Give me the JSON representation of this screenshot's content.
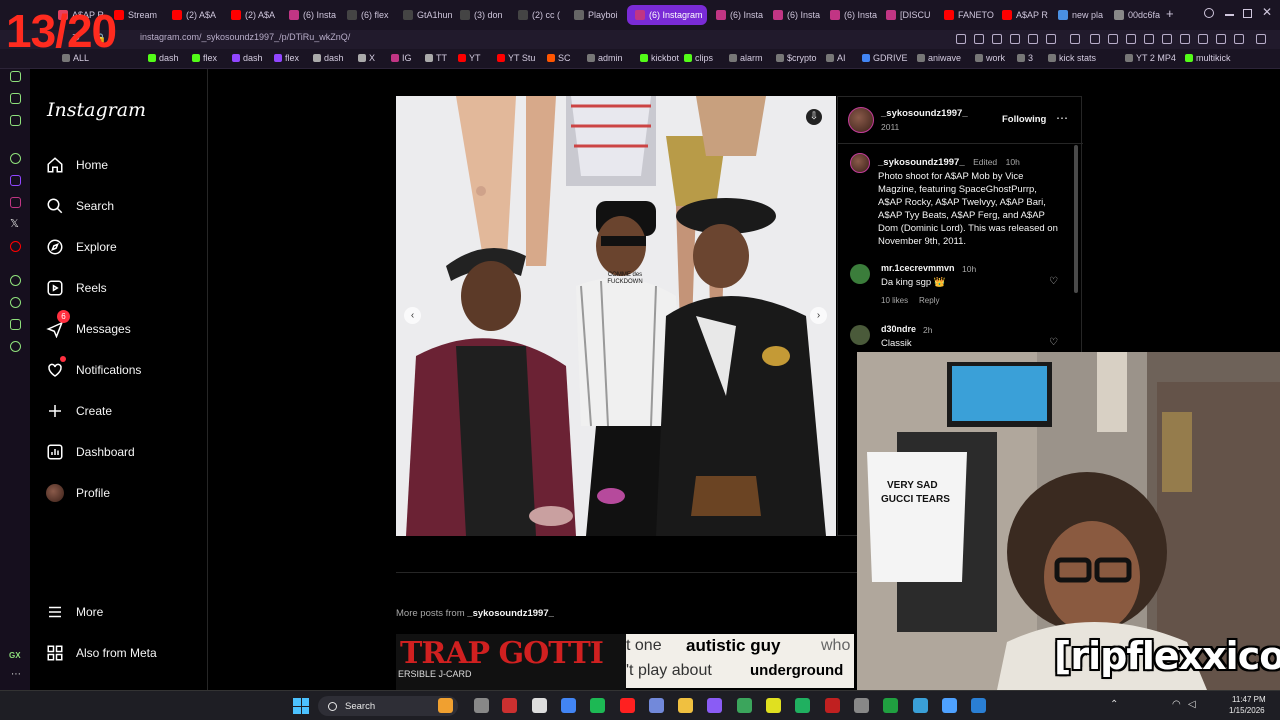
{
  "overlay_counter": "13/20",
  "browser": {
    "url": "instagram.com/_sykosoundz1997_/p/DTiRu_wkZnQ/",
    "tabs": [
      {
        "label": "A$AP R",
        "color": "#e4405f"
      },
      {
        "label": "Stream",
        "color": "#ff0000"
      },
      {
        "label": "(2) A$A",
        "color": "#ff0000"
      },
      {
        "label": "(2) A$A",
        "color": "#ff0000"
      },
      {
        "label": "(6) Insta",
        "color": "#c13584"
      },
      {
        "label": "(6) flex",
        "color": "#444"
      },
      {
        "label": "GtA1hun",
        "color": "#444"
      },
      {
        "label": "(3) don",
        "color": "#444"
      },
      {
        "label": "(2) cc (",
        "color": "#444"
      },
      {
        "label": "Playboi",
        "color": "#666"
      },
      {
        "label": "(6) Instagram",
        "color": "#c13584"
      },
      {
        "label": "(6) Insta",
        "color": "#c13584"
      },
      {
        "label": "(6) Insta",
        "color": "#c13584"
      },
      {
        "label": "(6) Insta",
        "color": "#c13584"
      },
      {
        "label": "[DISCU",
        "color": "#c13584"
      },
      {
        "label": "FANETO",
        "color": "#ff0000"
      },
      {
        "label": "A$AP R",
        "color": "#ff0000"
      },
      {
        "label": "new pla",
        "color": "#4a90e2"
      },
      {
        "label": "00dc6fa",
        "color": "#888"
      }
    ],
    "bookmarks": [
      {
        "label": "ALL",
        "color": "#777"
      },
      {
        "label": "dash",
        "color": "#53fc18"
      },
      {
        "label": "flex",
        "color": "#53fc18"
      },
      {
        "label": "dash",
        "color": "#9146ff"
      },
      {
        "label": "flex",
        "color": "#9146ff"
      },
      {
        "label": "dash",
        "color": "#aaa"
      },
      {
        "label": "X",
        "color": "#aaa"
      },
      {
        "label": "IG",
        "color": "#c13584"
      },
      {
        "label": "TT",
        "color": "#aaa"
      },
      {
        "label": "YT",
        "color": "#ff0000"
      },
      {
        "label": "YT Stu",
        "color": "#ff0000"
      },
      {
        "label": "SC",
        "color": "#ff5500"
      },
      {
        "label": "admin",
        "color": "#777"
      },
      {
        "label": "kickbot",
        "color": "#53fc18"
      },
      {
        "label": "clips",
        "color": "#53fc18"
      },
      {
        "label": "alarm",
        "color": "#777"
      },
      {
        "label": "$crypto",
        "color": "#777"
      },
      {
        "label": "AI",
        "color": "#777"
      },
      {
        "label": "GDRIVE",
        "color": "#4285f4"
      },
      {
        "label": "aniwave",
        "color": "#777"
      },
      {
        "label": "work",
        "color": "#777"
      },
      {
        "label": "3",
        "color": "#777"
      },
      {
        "label": "kick stats",
        "color": "#777"
      },
      {
        "label": "YT 2 MP4",
        "color": "#777"
      },
      {
        "label": "multikick",
        "color": "#53fc18"
      }
    ]
  },
  "instagram": {
    "logo": "Instagram",
    "nav": [
      {
        "label": "Home",
        "icon": "home-icon"
      },
      {
        "label": "Search",
        "icon": "search-icon"
      },
      {
        "label": "Explore",
        "icon": "explore-icon"
      },
      {
        "label": "Reels",
        "icon": "reels-icon"
      },
      {
        "label": "Messages",
        "icon": "messages-icon",
        "badge": "6"
      },
      {
        "label": "Notifications",
        "icon": "heart-icon"
      },
      {
        "label": "Create",
        "icon": "plus-icon"
      },
      {
        "label": "Dashboard",
        "icon": "dashboard-icon"
      },
      {
        "label": "Profile",
        "icon": "profile-avatar"
      }
    ],
    "bottom_nav": [
      {
        "label": "More",
        "icon": "menu-icon"
      },
      {
        "label": "Also from Meta",
        "icon": "meta-icon"
      }
    ]
  },
  "post": {
    "username": "_sykosoundz1997_",
    "header_sub": "2011",
    "follow_label": "Following",
    "caption_user": "_sykosoundz1997_",
    "caption_edited": "Edited",
    "caption_time": "10h",
    "caption": "Photo shoot for A$AP Mob by Vice Magzine, featuring SpaceGhostPurrp, A$AP Rocky, A$AP Twelvyy, A$AP Bari, A$AP Tyy Beats, A$AP Ferg, and A$AP Dom (Dominic Lord). This was released on November 9th, 2011.",
    "comments": [
      {
        "user": "mr.1cecrevmmvn",
        "time": "10h",
        "text": "Da king sgp 👑",
        "likes": "10 likes",
        "reply": "Reply"
      },
      {
        "user": "d30ndre",
        "time": "2h",
        "text": "Classik"
      }
    ],
    "photo_labels": {
      "shirt_text": "COMME des FUCKDOWN"
    }
  },
  "more_posts": {
    "prefix": "More posts from",
    "user": "_sykosoundz1997_"
  },
  "stream": {
    "lyrics_line1_a": "t one",
    "lyrics_line1_b": "autistic guy",
    "lyrics_line1_c": "who",
    "lyrics_line2_a": "'t play about",
    "lyrics_line2_b": "underground",
    "handle": "[ripflexxico]",
    "shirt_line1": "VERY SAD",
    "shirt_line2": "GUCCI TEARS",
    "banner_text": "TRAP GOTTI",
    "banner_sub": "ERSIBLE J-CARD"
  },
  "taskbar": {
    "search_label": "Search",
    "time": "11:47 PM",
    "date": "1/15/2026"
  }
}
